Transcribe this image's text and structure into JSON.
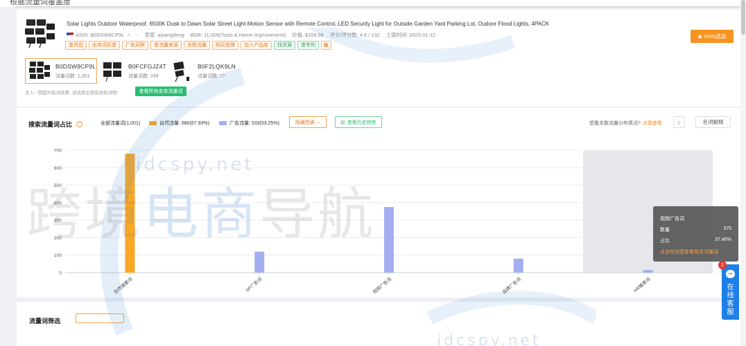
{
  "top_cut_text": "根据流量词覆盖度",
  "product": {
    "title": "Solar Lights Outdoor Waterproof, 6500K Dusk to Dawn Solar Street Light Motion Sensor with Remote Control, LED Security Light for Outside Garden Yard Parking Lot, Oudoor Flood Lights, 4PACK",
    "asin": "ASIN: B0DSW9CP9L",
    "seller": "卖家: aiyangdeng",
    "bsr": "BSR: 11,009(Tools & Home Improvement)",
    "price": "价格: $109.98",
    "rating": "评分/评分数: 4.6 / 132",
    "launch": "上架时间: 2025-01-12",
    "dash": "-",
    "tags": [
      "查货品",
      "出单词反查",
      "广告洞察",
      "查流量来源",
      "关联流量",
      "购买规律",
      "加入产品库"
    ],
    "green_tags": [
      "找货源",
      "查专利"
    ],
    "asin_select_label": "ASIN选品"
  },
  "variants": [
    {
      "asin": "B0DSW9CP9L",
      "count": "流量词数: 1,001"
    },
    {
      "asin": "B0FCFGJZ4T",
      "count": "流量词数: 249"
    },
    {
      "asin": "B0F2LQK9LN",
      "count": "流量词数: 77"
    }
  ],
  "variant_hint": "主人~ 想提升拓词效率, 试试用全部变体拓词吧:",
  "all_variant_button": "查看所有变体流量词",
  "chart_header": {
    "title": "搜索流量词占比",
    "total": "全部流量词(1,001)",
    "legend_natural": "自然流量: 680(67.93%)",
    "legend_ad": "广告流量: 533(53.25%)",
    "hide_chart": "隐藏图表",
    "history_trend": "查看历史趋势",
    "related_question": "想看关联流量分布情况?",
    "related_link": "点我查看",
    "terms": "名词解释"
  },
  "colors": {
    "natural": "#f9a825",
    "ad": "#a3aef0",
    "accent": "#f79320",
    "green": "#2bbd72"
  },
  "chart_data": {
    "type": "bar",
    "categories": [
      "自然搜索词",
      "SP广告词",
      "视频广告词",
      "品牌广告词",
      "HR推荐词"
    ],
    "values": [
      680,
      120,
      375,
      80,
      15
    ],
    "bar_colors": [
      "#f9a825",
      "#a3aef0",
      "#a3aef0",
      "#a3aef0",
      "#a3aef0"
    ],
    "ylim": [
      0,
      700
    ],
    "yticks": [
      0,
      100,
      200,
      300,
      400,
      500,
      600,
      700
    ],
    "highlighted_index": 4,
    "grid": true
  },
  "tooltip": {
    "title": "视频广告词",
    "count_label": "数量",
    "count_value": "375",
    "ratio_label": "占比",
    "ratio_value": "37.46%",
    "link": "点击柱状图查看相关流量词"
  },
  "bottom_section": {
    "title": "流量词筛选"
  },
  "service": {
    "badge": "2",
    "label": "在线客服"
  },
  "watermark": {
    "cn_gray1": "跨境",
    "cn_blue": "电商",
    "cn_gray2": "导航",
    "en": "idcspy.net"
  }
}
